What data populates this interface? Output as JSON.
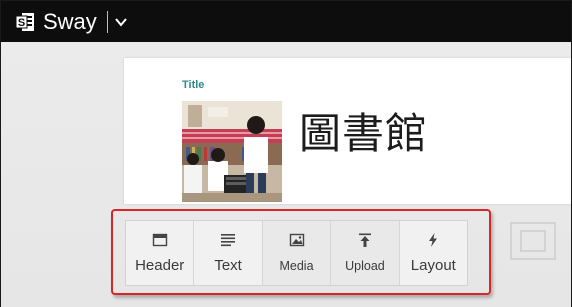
{
  "app": {
    "title": "Sway",
    "logo_icon": "sway-logo-icon",
    "menu_icon": "chevron-down-icon"
  },
  "card": {
    "label": "Title",
    "heading": "圖書館",
    "image": "photo of students in a library"
  },
  "toolbar": {
    "items": [
      {
        "label": "Header",
        "icon": "header-icon"
      },
      {
        "label": "Text",
        "icon": "text-lines-icon"
      },
      {
        "label": "Media",
        "icon": "image-icon"
      },
      {
        "label": "Upload",
        "icon": "upload-icon"
      },
      {
        "label": "Layout",
        "icon": "lightning-icon"
      }
    ]
  },
  "colors": {
    "topbar": "#0d0d0d",
    "label_teal": "#2e8b8b",
    "highlight_red": "#d9262a"
  }
}
